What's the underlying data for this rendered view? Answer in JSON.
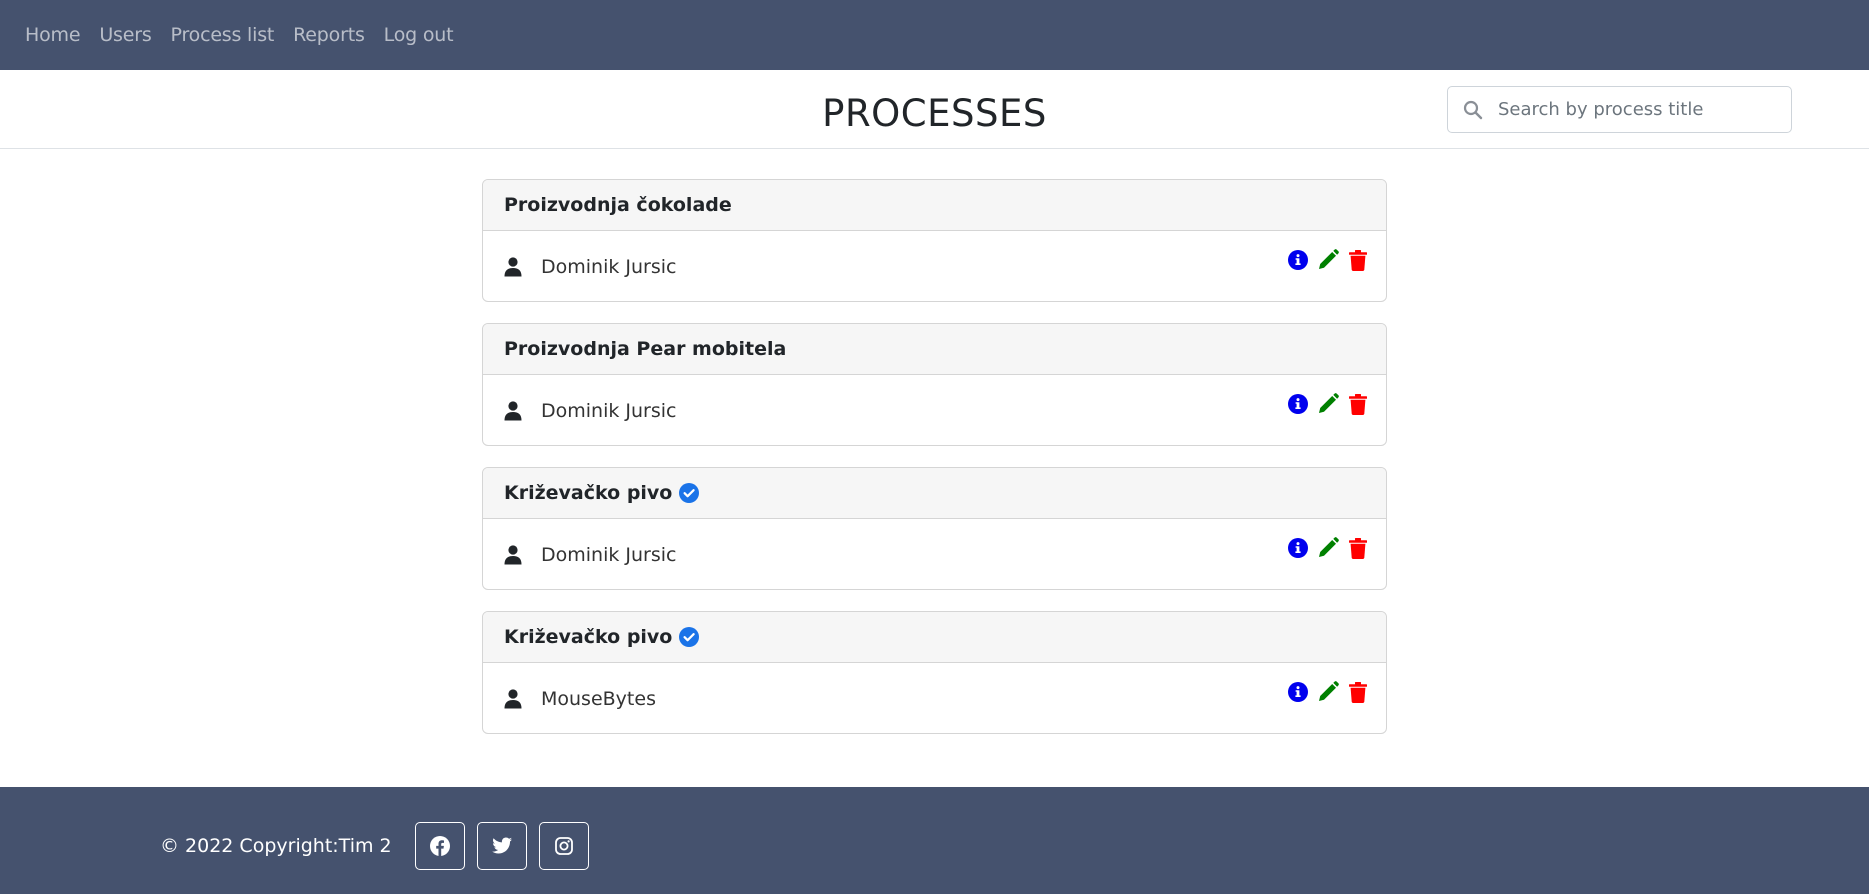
{
  "nav": {
    "items": [
      {
        "label": "Home"
      },
      {
        "label": "Users"
      },
      {
        "label": "Process list"
      },
      {
        "label": "Reports"
      },
      {
        "label": "Log out"
      }
    ]
  },
  "header": {
    "title": "PROCESSES",
    "search": {
      "placeholder": "Search by process title",
      "value": ""
    }
  },
  "processes": [
    {
      "title": "Proizvodnja čokolade",
      "verified": false,
      "owner": "Dominik Jursic"
    },
    {
      "title": "Proizvodnja Pear mobitela",
      "verified": false,
      "owner": "Dominik Jursic"
    },
    {
      "title": "Križevačko pivo",
      "verified": true,
      "owner": "Dominik Jursic"
    },
    {
      "title": "Križevačko pivo",
      "verified": true,
      "owner": "MouseBytes"
    }
  ],
  "icons": {
    "user": "user-icon",
    "verified": "verified-check-icon",
    "info": "info-icon",
    "edit": "pencil-icon",
    "delete": "trash-icon",
    "search": "search-icon"
  },
  "colors": {
    "navbar": "#45526e",
    "info": "#0000ee",
    "edit": "#008000",
    "delete": "#ff0000",
    "verified": "#1a73e8"
  },
  "footer": {
    "copyright": "© 2022 Copyright:Tim 2",
    "social": [
      {
        "name": "facebook"
      },
      {
        "name": "twitter"
      },
      {
        "name": "instagram"
      }
    ]
  }
}
